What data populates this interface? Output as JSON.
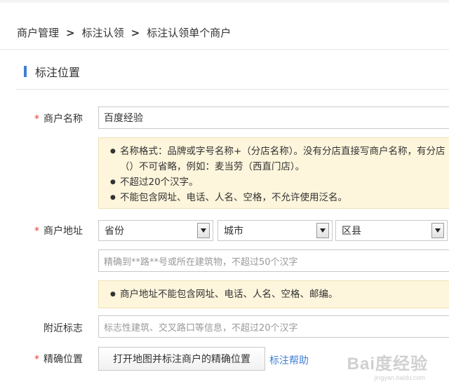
{
  "breadcrumb": {
    "items": [
      "商户管理",
      "标注认领",
      "标注认领单个商户"
    ],
    "separator": ">"
  },
  "section": {
    "title": "标注位置"
  },
  "form": {
    "merchant_name": {
      "label": "商户名称",
      "required_mark": "*",
      "value": "百度经验"
    },
    "name_tips": [
      "名称格式：品牌或字号名称+（分店名称）。没有分店直接写商户名称，有分店（）不可省略，例如：麦当劳（西直门店）。",
      "不超过20个汉字。",
      "不能包含网址、电话、人名、空格，不允许使用泛名。"
    ],
    "merchant_address": {
      "label": "商户地址",
      "required_mark": "*",
      "province": "省份",
      "city": "城市",
      "district": "区县",
      "detail_placeholder": "精确到**路**号或所在建筑物，不超过50个汉字"
    },
    "address_tips": [
      "商户地址不能包含网址、电话、人名、空格、邮编。"
    ],
    "landmark": {
      "label": "附近标志",
      "placeholder": "标志性建筑、交叉路口等信息，不超过20个汉字"
    },
    "precise_location": {
      "label": "精确位置",
      "required_mark": "*",
      "button_label": "打开地图并标注商户的精确位置",
      "help_link": "标注帮助"
    }
  },
  "watermark": {
    "text": "Bai度经验",
    "url": "jingyan.baidu.com"
  },
  "colors": {
    "accent": "#3f7fd6",
    "required": "#e4393c",
    "notice_bg": "#fdf5dc"
  }
}
